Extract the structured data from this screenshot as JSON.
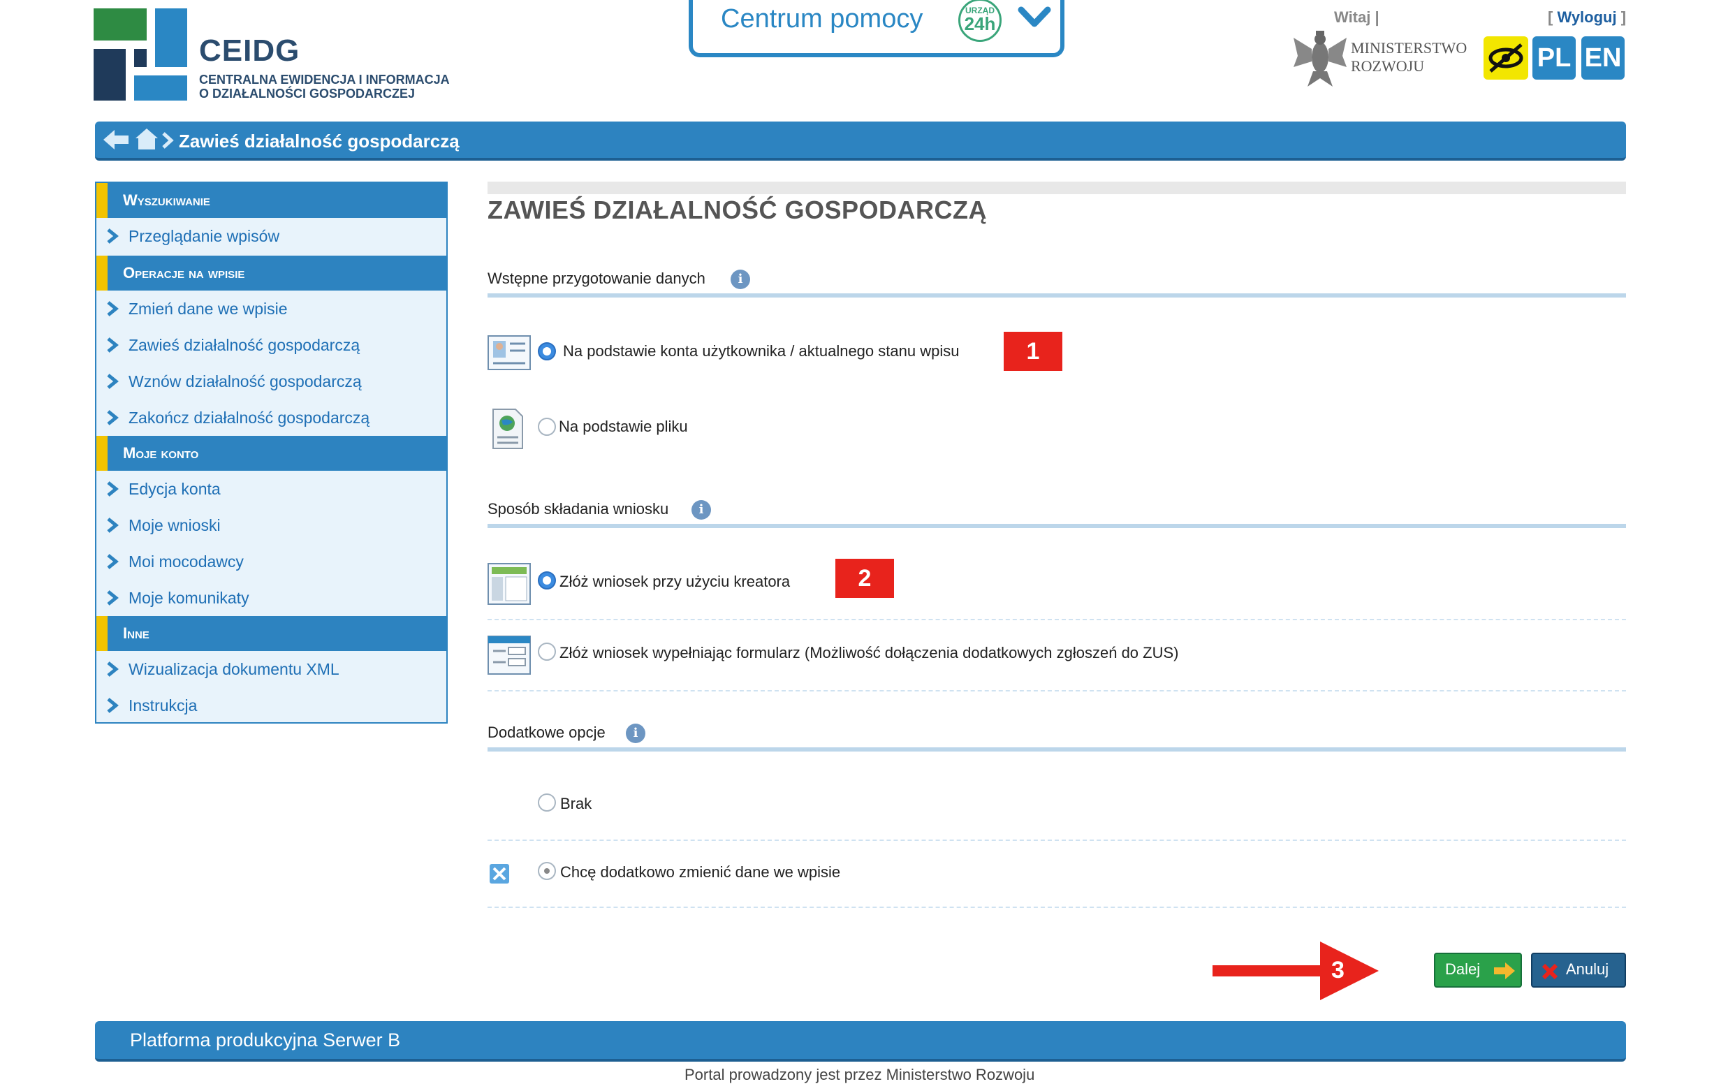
{
  "header": {
    "logo_title": "CEIDG",
    "logo_subtitle_1": "CENTRALNA EWIDENCJA I INFORMACJA",
    "logo_subtitle_2": "O DZIAŁALNOŚCI GOSPODARCZEJ",
    "help_label": "Centrum pomocy",
    "help_badge_top": "URZĄD",
    "help_badge_main": "24h",
    "greeting": "Witaj |",
    "logout_open": "[",
    "logout_label": "Wyloguj",
    "logout_close": "]",
    "ministry_line1": "MINISTERSTWO",
    "ministry_line2": "ROZWOJU",
    "lang_pl": "PL",
    "lang_en": "EN"
  },
  "breadcrumb": {
    "current": "Zawieś działalność gospodarczą"
  },
  "sidebar": {
    "sections": [
      {
        "title": "Wyszukiwanie",
        "items": [
          "Przeglądanie wpisów"
        ]
      },
      {
        "title": "Operacje na wpisie",
        "items": [
          "Zmień dane we wpisie",
          "Zawieś działalność gospodarczą",
          "Wznów działalność gospodarczą",
          "Zakończ działalność gospodarczą"
        ]
      },
      {
        "title": "Moje konto",
        "items": [
          "Edycja konta",
          "Moje wnioski",
          "Moi mocodawcy",
          "Moje komunikaty"
        ]
      },
      {
        "title": "Inne",
        "items": [
          "Wizualizacja dokumentu XML",
          "Instrukcja"
        ]
      }
    ]
  },
  "main": {
    "title": "ZAWIEŚ DZIAŁALNOŚĆ GOSPODARCZĄ",
    "info_glyph": "i",
    "sections": [
      {
        "label": "Wstępne przygotowanie danych",
        "options": [
          "Na podstawie konta użytkownika / aktualnego stanu wpisu",
          "Na podstawie pliku"
        ],
        "selected": 0
      },
      {
        "label": "Sposób składania wniosku",
        "options": [
          "Złóż wniosek przy użyciu kreatora",
          "Złóż wniosek wypełniając formularz (Możliwość dołączenia dodatkowych zgłoszeń do ZUS)"
        ],
        "selected": 0
      },
      {
        "label": "Dodatkowe opcje",
        "options": [
          "Brak",
          "Chcę dodatkowo zmienić dane we wpisie"
        ],
        "selected": 1
      }
    ],
    "annotations": [
      "1",
      "2",
      "3"
    ],
    "buttons": {
      "next": "Dalej",
      "cancel": "Anuluj"
    }
  },
  "footer": {
    "platform": "Platforma produkcyjna Serwer B",
    "note": "Portal prowadzony jest przez Ministerstwo Rozwoju"
  },
  "colors": {
    "accent": "#2d83c0",
    "highlight": "#f2c300",
    "annotation": "#e8231c",
    "next": "#2aa14a",
    "cancel": "#26628f"
  }
}
